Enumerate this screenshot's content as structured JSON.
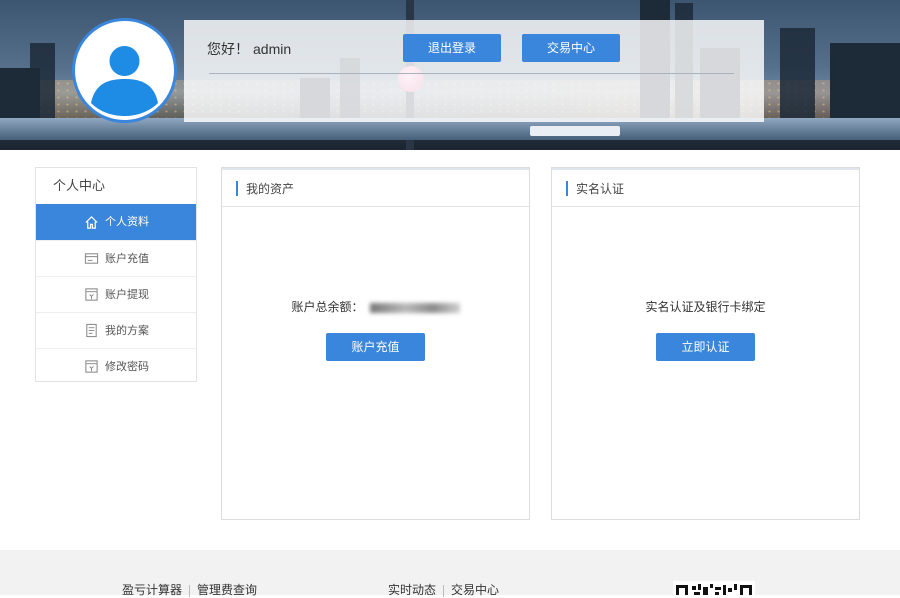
{
  "header": {
    "greeting": "您好！",
    "username": "admin",
    "logout_label": "退出登录",
    "trade_center_label": "交易中心"
  },
  "sidebar": {
    "title": "个人中心",
    "items": [
      {
        "label": "个人资料",
        "icon": "home-icon",
        "active": true
      },
      {
        "label": "账户充值",
        "icon": "card-icon",
        "active": false
      },
      {
        "label": "账户提现",
        "icon": "withdraw-icon",
        "active": false
      },
      {
        "label": "我的方案",
        "icon": "document-icon",
        "active": false
      },
      {
        "label": "修改密码",
        "icon": "lock-icon",
        "active": false
      }
    ]
  },
  "assets_card": {
    "title": "我的资产",
    "balance_label": "账户总余额：",
    "recharge_button": "账户充值"
  },
  "verify_card": {
    "title": "实名认证",
    "description": "实名认证及银行卡绑定",
    "verify_button": "立即认证"
  },
  "footer": {
    "left_links": [
      "盈亏计算器",
      "管理费查询"
    ],
    "middle_links": [
      "实时动态",
      "交易中心"
    ]
  },
  "colors": {
    "accent": "#3a86dc",
    "footer_bg": "#f2f2f2"
  }
}
